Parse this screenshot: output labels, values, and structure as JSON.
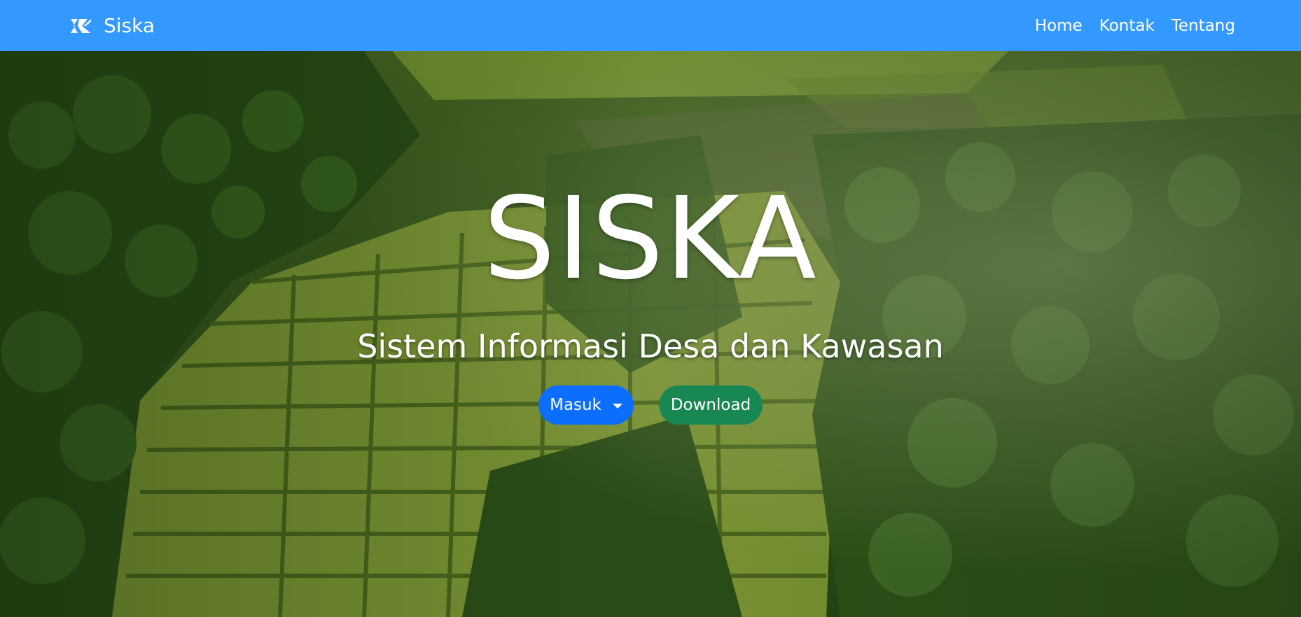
{
  "navbar": {
    "brand_name": "Siska",
    "brand_icon": "siska-logo-icon",
    "links": [
      {
        "label": "Home"
      },
      {
        "label": "Kontak"
      },
      {
        "label": "Tentang"
      }
    ],
    "color": "#3399ff"
  },
  "hero": {
    "title": "SISKA",
    "subtitle": "Sistem Informasi Desa dan Kawasan",
    "background": "aerial-rice-terraces-photo",
    "buttons": {
      "login_label": "Masuk",
      "download_label": "Download"
    },
    "colors": {
      "primary": "#0d6efd",
      "success": "#198754"
    }
  }
}
